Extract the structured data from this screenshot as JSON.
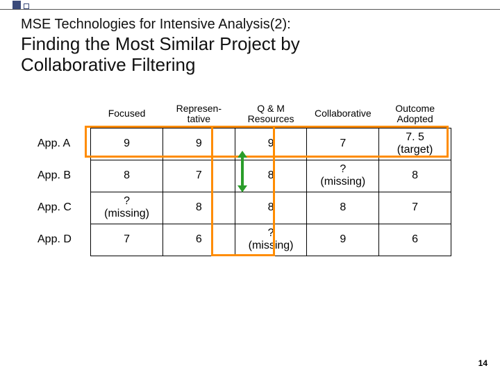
{
  "pretitle": "MSE Technologies for Intensive Analysis(2):",
  "title_l1": "Finding the Most Similar Project by",
  "title_l2": "Collaborative Filtering",
  "headers": {
    "c1": "Focused",
    "c2a": "Represen-",
    "c2b": "tative",
    "c3a": "Q & M",
    "c3b": "Resources",
    "c4": "Collaborative",
    "c5a": "Outcome",
    "c5b": "Adopted"
  },
  "rows": [
    {
      "label": "App. A",
      "c1": "9",
      "c2": "9",
      "c3": "9",
      "c4": "7",
      "c5a": "7. 5",
      "c5b": "(target)"
    },
    {
      "label": "App. B",
      "c1": "8",
      "c2": "7",
      "c3": "8",
      "c4a": "?",
      "c4b": "(missing)",
      "c5": "8"
    },
    {
      "label": "App. C",
      "c1a": "?",
      "c1b": "(missing)",
      "c2": "8",
      "c3": "8",
      "c4": "8",
      "c5": "7"
    },
    {
      "label": "App. D",
      "c1": "7",
      "c2": "6",
      "c3a": "?",
      "c3b": "(missing)",
      "c4": "9",
      "c5": "6"
    }
  ],
  "page_number": "14"
}
